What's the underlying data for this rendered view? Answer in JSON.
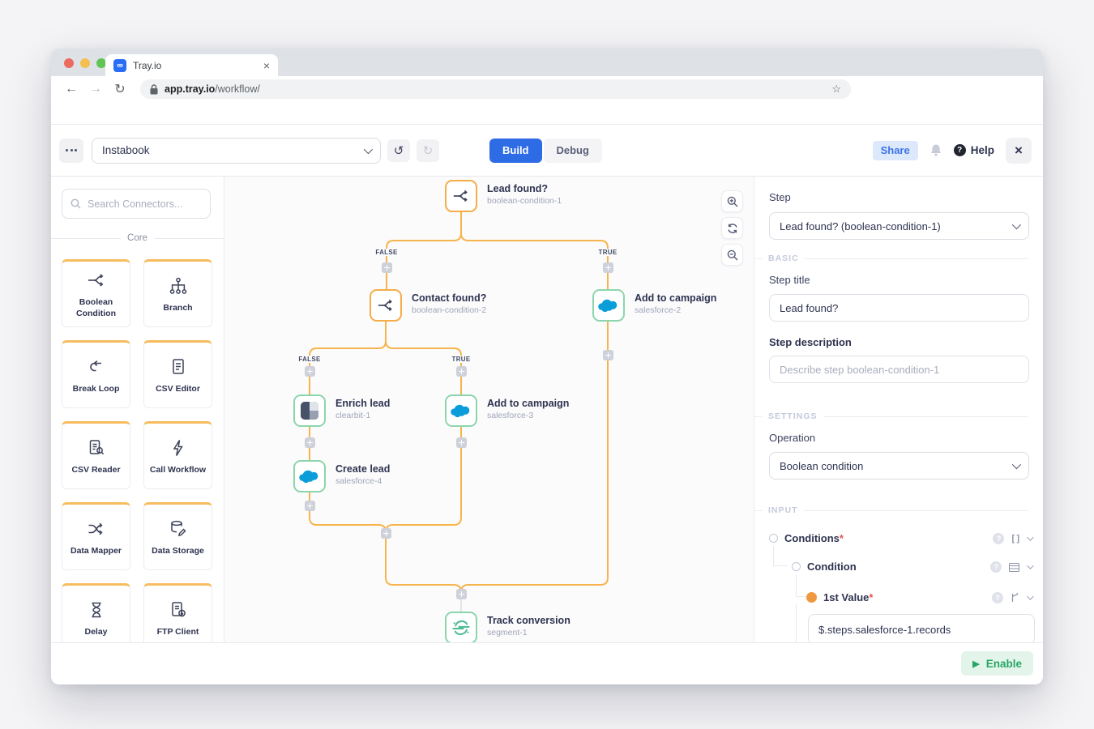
{
  "browser": {
    "tab_title": "Tray.io",
    "url_domain": "app.tray.io",
    "url_path": "/workflow/"
  },
  "toolbar": {
    "workflow_name": "Instabook",
    "build_label": "Build",
    "debug_label": "Debug",
    "share_label": "Share",
    "help_label": "Help"
  },
  "sidebar": {
    "search_placeholder": "Search Connectors...",
    "section_label": "Core",
    "connectors": [
      {
        "label": "Boolean Condition",
        "icon": "boolean-condition-icon"
      },
      {
        "label": "Branch",
        "icon": "branch-icon"
      },
      {
        "label": "Break Loop",
        "icon": "break-loop-icon"
      },
      {
        "label": "CSV Editor",
        "icon": "csv-editor-icon"
      },
      {
        "label": "CSV Reader",
        "icon": "csv-reader-icon"
      },
      {
        "label": "Call Workflow",
        "icon": "call-workflow-icon"
      },
      {
        "label": "Data Mapper",
        "icon": "data-mapper-icon"
      },
      {
        "label": "Data Storage",
        "icon": "data-storage-icon"
      },
      {
        "label": "Delay",
        "icon": "delay-icon"
      },
      {
        "label": "FTP Client",
        "icon": "ftp-client-icon"
      }
    ]
  },
  "canvas": {
    "branch_labels": {
      "false": "FALSE",
      "true": "TRUE"
    },
    "nodes": [
      {
        "title": "Lead found?",
        "subtitle": "boolean-condition-1",
        "icon": "boolean-condition-icon"
      },
      {
        "title": "Contact found?",
        "subtitle": "boolean-condition-2",
        "icon": "boolean-condition-icon"
      },
      {
        "title": "Add to campaign",
        "subtitle": "salesforce-2",
        "icon": "salesforce-icon"
      },
      {
        "title": "Enrich lead",
        "subtitle": "clearbit-1",
        "icon": "clearbit-icon"
      },
      {
        "title": "Add to campaign",
        "subtitle": "salesforce-3",
        "icon": "salesforce-icon"
      },
      {
        "title": "Create lead",
        "subtitle": "salesforce-4",
        "icon": "salesforce-icon"
      },
      {
        "title": "Track conversion",
        "subtitle": "segment-1",
        "icon": "segment-icon"
      }
    ]
  },
  "inspector": {
    "step_label": "Step",
    "step_value": "Lead found? (boolean-condition-1)",
    "basic_section": "BASIC",
    "step_title_label": "Step title",
    "step_title_value": "Lead found?",
    "step_description_label": "Step description",
    "step_description_placeholder": "Describe step boolean-condition-1",
    "settings_section": "SETTINGS",
    "operation_label": "Operation",
    "operation_value": "Boolean condition",
    "input_section": "INPUT",
    "conditions_label": "Conditions",
    "condition_label": "Condition",
    "first_value_label": "1st Value",
    "required_marker": "*",
    "first_value_input": "$.steps.salesforce-1.records"
  },
  "footer": {
    "enable_label": "Enable"
  },
  "colors": {
    "accent_blue": "#2e6ce5",
    "connector_orange": "#f7b44d",
    "node_border_orange": "#f5ad49",
    "node_border_green": "#8cd5ac",
    "enable_green": "#28a664",
    "salesforce_blue": "#0b9dd9",
    "segment_green": "#52bd95"
  }
}
